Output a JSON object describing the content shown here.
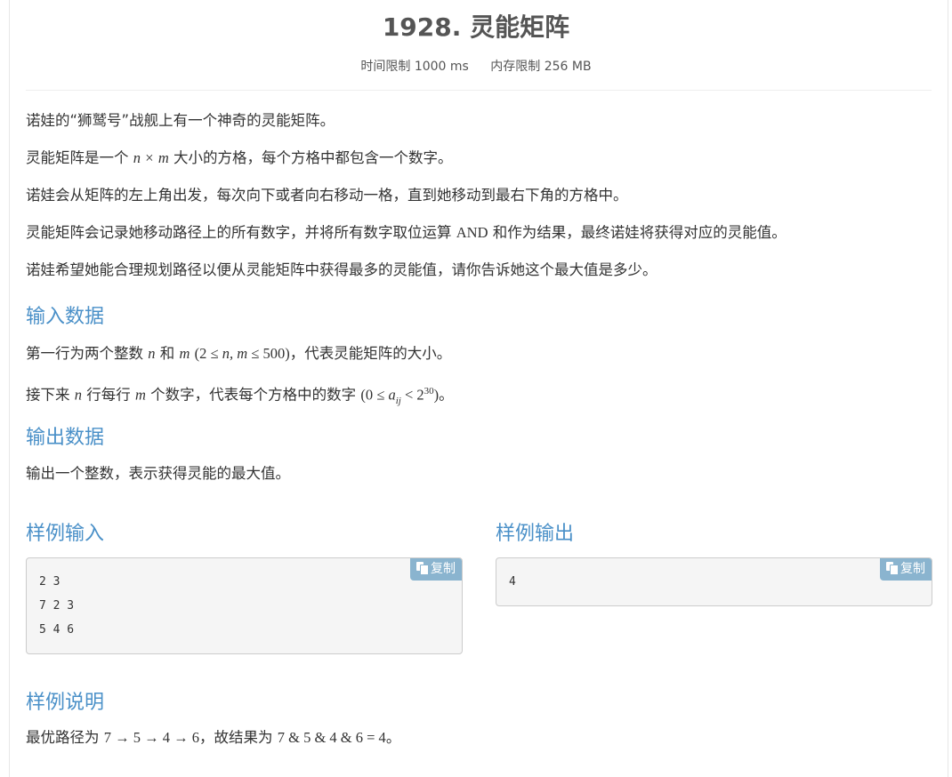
{
  "problem": {
    "title": "1928. 灵能矩阵",
    "time_limit": "时间限制 1000 ms",
    "memory_limit": "内存限制 256 MB"
  },
  "description": {
    "p1": "诺娃的“狮鹫号”战舰上有一个神奇的灵能矩阵。",
    "p2_pre": "灵能矩阵是一个",
    "p2_n": "n",
    "p2_times": "×",
    "p2_m": "m",
    "p2_post": "大小的方格，每个方格中都包含一个数字。",
    "p3": "诺娃会从矩阵的左上角出发，每次向下或者向右移动一格，直到她移动到最右下角的方格中。",
    "p4_pre": "灵能矩阵会记录她移动路径上的所有数字，并将所有数字取位运算",
    "p4_and": "AND",
    "p4_post": "和作为结果，最终诺娃将获得对应的灵能值。",
    "p5": "诺娃希望她能合理规划路径以便从灵能矩阵中获得最多的灵能值，请你告诉她这个最大值是多少。"
  },
  "input_section": {
    "heading": "输入数据",
    "l1_pre": "第一行为两个整数",
    "l1_n": "n",
    "l1_and": "和",
    "l1_m": "m",
    "l1_cond_open": "(2 ≤ ",
    "l1_cond_vars": "n, m",
    "l1_cond_close": " ≤ 500)",
    "l1_post": "，代表灵能矩阵的大小。",
    "l2_pre": "接下来",
    "l2_n": "n",
    "l2_mid1": "行每行",
    "l2_m": "m",
    "l2_mid2": "个数字，代表每个方格中的数字",
    "l2_cond_open": "(0 ≤ ",
    "l2_a": "a",
    "l2_sub": "ij",
    "l2_lt": " < 2",
    "l2_sup": "30",
    "l2_close": ")",
    "l2_post": "。"
  },
  "output_section": {
    "heading": "输出数据",
    "text": "输出一个整数，表示获得灵能的最大值。"
  },
  "sample_input": {
    "heading": "样例输入",
    "copy_label": "复制",
    "lines": [
      "2 3",
      "7 2 3",
      "5 4 6"
    ]
  },
  "sample_output": {
    "heading": "样例输出",
    "copy_label": "复制",
    "lines": [
      "4"
    ]
  },
  "explanation": {
    "heading": "样例说明",
    "pre": "最优路径为",
    "path": "7 → 5 → 4 → 6",
    "mid": "，故结果为",
    "expr": "7 & 5 & 4 & 6 = 4",
    "post": "。"
  },
  "colors": {
    "heading_blue": "#4a90c8",
    "copy_button": "#8ab4cf",
    "sample_bg": "#f5f5f5"
  },
  "icons": [
    "copy-icon"
  ]
}
